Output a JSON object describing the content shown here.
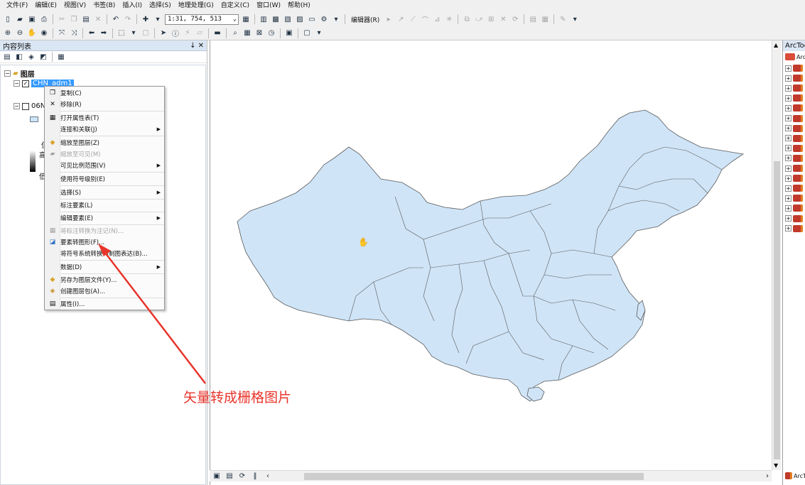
{
  "menubar": {
    "items": [
      "文件(F)",
      "编辑(E)",
      "视图(V)",
      "书签(B)",
      "插入(I)",
      "选择(S)",
      "地理处理(G)",
      "自定义(C)",
      "窗口(W)",
      "帮助(H)"
    ]
  },
  "toolbar": {
    "scale_value": "1:31, 754, 513",
    "editor_label": "编辑器(R)"
  },
  "toc": {
    "title": "内容列表",
    "pin": "↓ ✕",
    "root_layer": "图层",
    "layer1_name": "CHN_adm1",
    "layer2_name": "06N",
    "legend_high": "高",
    "legend_low": "低",
    "legend_mid": "值"
  },
  "context_menu": {
    "items": [
      {
        "label": "复制(C)",
        "icon": "copy-icon"
      },
      {
        "label": "移除(R)",
        "icon": "remove-icon"
      },
      {
        "label": "打开属性表(T)",
        "icon": "table-icon"
      },
      {
        "label": "连接和关联(J)",
        "icon": "",
        "submenu": true
      },
      {
        "label": "缩放至图层(Z)",
        "icon": "zoom-layer-icon"
      },
      {
        "label": "缩放至可见(M)",
        "icon": "zoom-visible-icon",
        "disabled": true
      },
      {
        "label": "可见比例范围(V)",
        "icon": "",
        "submenu": true
      },
      {
        "label": "使用符号级别(E)",
        "icon": ""
      },
      {
        "label": "选择(S)",
        "icon": "",
        "submenu": true
      },
      {
        "label": "标注要素(L)",
        "icon": ""
      },
      {
        "label": "编辑要素(E)",
        "icon": "",
        "submenu": true
      },
      {
        "label": "将标注转换为注记(N)...",
        "icon": "annotation-icon",
        "disabled": true
      },
      {
        "label": "要素转图形(F)...",
        "icon": "features-to-graphics-icon"
      },
      {
        "label": "将符号系统转换为制图表达(B)...",
        "icon": ""
      },
      {
        "label": "数据(D)",
        "icon": "",
        "submenu": true
      },
      {
        "label": "另存为图层文件(Y)...",
        "icon": "save-layer-icon"
      },
      {
        "label": "创建图层包(A)...",
        "icon": "layer-package-icon"
      },
      {
        "label": "属性(I)...",
        "icon": "properties-icon"
      }
    ]
  },
  "arctoolbox": {
    "title": "ArcToolbox",
    "root": "ArcToolbox",
    "bottom_tab": "ArcToolbox"
  },
  "annotation": {
    "text": "矢量转成栅格图片",
    "color": "#e8352b"
  },
  "map": {
    "fill_color": "#cfe4f7",
    "stroke_color": "#5a5a5a"
  }
}
